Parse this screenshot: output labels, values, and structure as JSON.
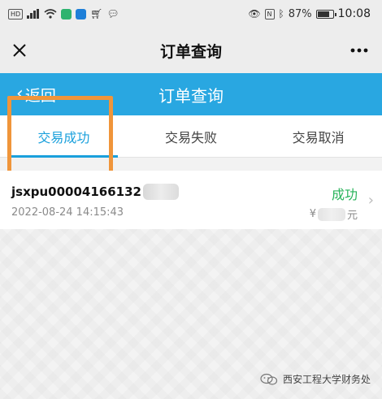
{
  "status_bar": {
    "left_icons": [
      "hd-icon",
      "signal-icon",
      "wifi-icon",
      "app-icon",
      "app-icon",
      "cart-icon",
      "chat-icon"
    ],
    "battery": "87%",
    "time": "10:08"
  },
  "top_bar": {
    "title": "订单查询",
    "close_icon": "close-icon",
    "more_icon": "more-icon"
  },
  "page_header": {
    "back_label": "返回",
    "title": "订单查询",
    "color": "#29a7e1"
  },
  "tabs": [
    {
      "label": "交易成功",
      "active": true
    },
    {
      "label": "交易失败",
      "active": false
    },
    {
      "label": "交易取消",
      "active": false
    }
  ],
  "orders": [
    {
      "order_no": "jsxpu00004166132",
      "time": "2022-08-24 14:15:43",
      "status": "成功",
      "currency": "¥",
      "unit": "元"
    }
  ],
  "watermark": "西安工程大学财务处",
  "colors": {
    "accent": "#29a7e1",
    "tab_active": "#1aa0dc",
    "success": "#27b35a",
    "annotation": "#f0953a"
  }
}
